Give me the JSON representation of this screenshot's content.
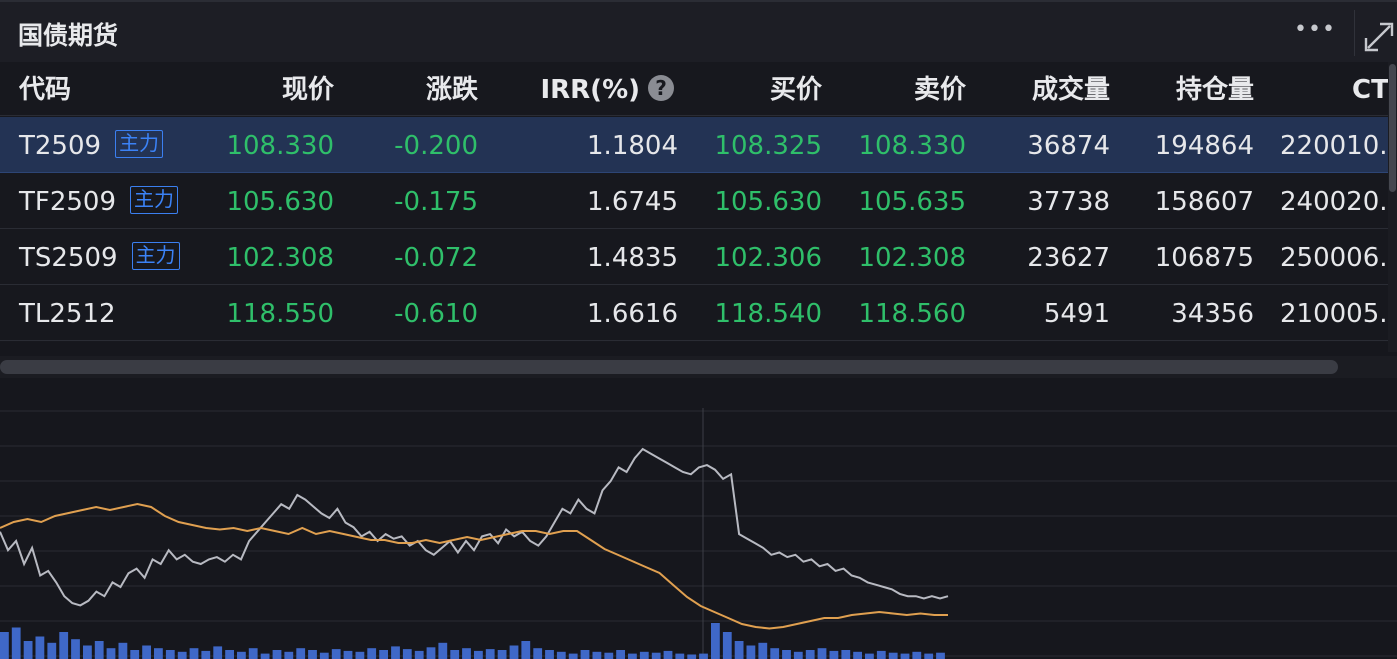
{
  "panel": {
    "title": "国债期货"
  },
  "table": {
    "headers": [
      "代码",
      "现价",
      "涨跌",
      "IRR(%)",
      "买价",
      "卖价",
      "成交量",
      "持仓量",
      "CT"
    ],
    "rows": [
      {
        "code": "T2509",
        "badge": "主力",
        "price": "108.330",
        "change": "-0.200",
        "irr": "1.1804",
        "bid": "108.325",
        "ask": "108.330",
        "volume": "36874",
        "oi": "194864",
        "ct": "220010."
      },
      {
        "code": "TF2509",
        "badge": "主力",
        "price": "105.630",
        "change": "-0.175",
        "irr": "1.6745",
        "bid": "105.630",
        "ask": "105.635",
        "volume": "37738",
        "oi": "158607",
        "ct": "240020."
      },
      {
        "code": "TS2509",
        "badge": "主力",
        "price": "102.308",
        "change": "-0.072",
        "irr": "1.4835",
        "bid": "102.306",
        "ask": "102.308",
        "volume": "23627",
        "oi": "106875",
        "ct": "250006."
      },
      {
        "code": "TL2512",
        "badge": "",
        "price": "118.550",
        "change": "-0.610",
        "irr": "1.6616",
        "bid": "118.540",
        "ask": "118.560",
        "volume": "5491",
        "oi": "34356",
        "ct": "210005."
      }
    ]
  },
  "colors": {
    "accent": "#3b82f6",
    "down_green": "#2fbf6a",
    "price_line": "#b8bac2",
    "avg_line": "#e0a050",
    "volume_bar": "#3f68c8"
  },
  "icons": {
    "menu": "ellipsis-icon",
    "expand": "expand-icon",
    "help": "question-icon"
  },
  "chart_data": {
    "type": "line",
    "series": [
      {
        "values": [
          0.74,
          0.66,
          0.7,
          0.6,
          0.67,
          0.55,
          0.57,
          0.52,
          0.46,
          0.43,
          0.42,
          0.44,
          0.48,
          0.46,
          0.52,
          0.5,
          0.56,
          0.58,
          0.54,
          0.62,
          0.6,
          0.66,
          0.62,
          0.64,
          0.61,
          0.6,
          0.62,
          0.63,
          0.61,
          0.64,
          0.62,
          0.7,
          0.74,
          0.78,
          0.82,
          0.86,
          0.84,
          0.9,
          0.88,
          0.85,
          0.82,
          0.8,
          0.84,
          0.78,
          0.76,
          0.72,
          0.74,
          0.7,
          0.73,
          0.71,
          0.72,
          0.68,
          0.7,
          0.66,
          0.64,
          0.67,
          0.7,
          0.65,
          0.7,
          0.66,
          0.72,
          0.73,
          0.69,
          0.75,
          0.72,
          0.74,
          0.7,
          0.68,
          0.72,
          0.78,
          0.84,
          0.82,
          0.88,
          0.84,
          0.82,
          0.92,
          0.96,
          1.02,
          1.0,
          1.06,
          1.1,
          1.08,
          1.06,
          1.04,
          1.02,
          1.0,
          0.99,
          1.02,
          1.03,
          1.01,
          0.97,
          0.99,
          0.73,
          0.71,
          0.69,
          0.67,
          0.64,
          0.65,
          0.63,
          0.64,
          0.61,
          0.62,
          0.59,
          0.6,
          0.57,
          0.58,
          0.55,
          0.54,
          0.52,
          0.51,
          0.5,
          0.49,
          0.47,
          0.46,
          0.46,
          0.45,
          0.46,
          0.45,
          0.46
        ]
      },
      {
        "values": [
          0.46,
          0.48,
          0.49,
          0.48,
          0.5,
          0.51,
          0.52,
          0.53,
          0.52,
          0.53,
          0.54,
          0.53,
          0.5,
          0.48,
          0.47,
          0.46,
          0.455,
          0.46,
          0.45,
          0.46,
          0.45,
          0.44,
          0.46,
          0.44,
          0.45,
          0.44,
          0.43,
          0.42,
          0.42,
          0.41,
          0.41,
          0.42,
          0.41,
          0.42,
          0.43,
          0.42,
          0.43,
          0.44,
          0.45,
          0.45,
          0.44,
          0.45,
          0.45,
          0.42,
          0.39,
          0.37,
          0.35,
          0.33,
          0.31,
          0.27,
          0.23,
          0.2,
          0.18,
          0.16,
          0.14,
          0.13,
          0.125,
          0.13,
          0.14,
          0.15,
          0.16,
          0.16,
          0.17,
          0.175,
          0.18,
          0.175,
          0.17,
          0.175,
          0.17,
          0.17
        ]
      },
      {
        "values": [
          0.03,
          0.035,
          0.02,
          0.025,
          0.018,
          0.03,
          0.022,
          0.015,
          0.02,
          0.012,
          0.018,
          0.01,
          0.015,
          0.012,
          0.01,
          0.008,
          0.012,
          0.009,
          0.014,
          0.01,
          0.008,
          0.012,
          0.006,
          0.01,
          0.008,
          0.012,
          0.01,
          0.007,
          0.011,
          0.009,
          0.008,
          0.012,
          0.01,
          0.014,
          0.011,
          0.009,
          0.013,
          0.018,
          0.01,
          0.012,
          0.009,
          0.011,
          0.01,
          0.015,
          0.02,
          0.012,
          0.01,
          0.008,
          0.006,
          0.01,
          0.008,
          0.007,
          0.01,
          0.006,
          0.008,
          0.007,
          0.009,
          0.006,
          0.005,
          0.006,
          0.04,
          0.03,
          0.02,
          0.015,
          0.018,
          0.012,
          0.01,
          0.008,
          0.01,
          0.012,
          0.009,
          0.01,
          0.008,
          0.006,
          0.009,
          0.007,
          0.006,
          0.008,
          0.006,
          0.007
        ]
      }
    ]
  }
}
